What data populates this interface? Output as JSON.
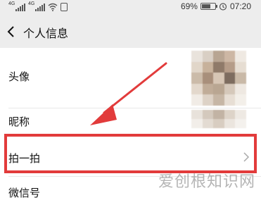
{
  "status_bar": {
    "signal1_label": "4G",
    "signal2_label": "4G",
    "battery": "69%",
    "battery_level": 0.69,
    "time": "07:20",
    "icons": [
      "signal-icon",
      "signal-icon",
      "wifi-icon",
      "vibrate-icon",
      "battery-icon",
      "alarm-icon"
    ]
  },
  "nav": {
    "back_icon": "chevron-left-icon",
    "title": "个人信息"
  },
  "rows": [
    {
      "label": "头像"
    },
    {
      "label": "昵称"
    },
    {
      "label": "拍一拍"
    },
    {
      "label": "微信号"
    }
  ],
  "annotation": {
    "color": "#e23b3b"
  },
  "watermark": "爱创根知识网"
}
